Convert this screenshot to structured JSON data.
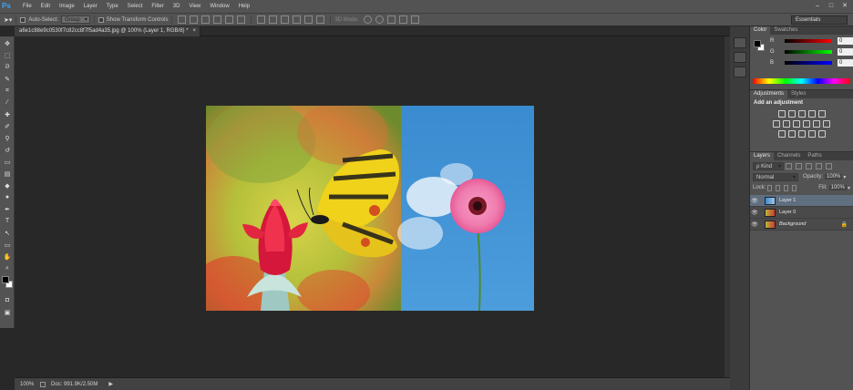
{
  "app": {
    "logo": "Ps",
    "menus": [
      "File",
      "Edit",
      "Image",
      "Layer",
      "Type",
      "Select",
      "Filter",
      "3D",
      "View",
      "Window",
      "Help"
    ]
  },
  "window_controls": {
    "minimize": "–",
    "maximize": "□",
    "close": "✕"
  },
  "options": {
    "auto_select_label": "Auto-Select:",
    "auto_select_value": "Group",
    "transform_label": "Show Transform Controls",
    "mode_3d_label": "3D Mode:",
    "workspace": "Essentials"
  },
  "document": {
    "tab_title": "a6e1c88e9c0530f7c82cc8f7f5ad4a35.jpg @ 100% (Layer 1, RGB/8) *",
    "tab_close": "×"
  },
  "status": {
    "zoom": "100%",
    "doc_info": "Doc: 991.9K/2.50M",
    "arrow": "▶"
  },
  "color_panel": {
    "tabs": [
      "Color",
      "Swatches"
    ],
    "channels": [
      {
        "label": "R",
        "value": "0"
      },
      {
        "label": "G",
        "value": "0"
      },
      {
        "label": "B",
        "value": "0"
      }
    ]
  },
  "adjustments_panel": {
    "tabs": [
      "Adjustments",
      "Styles"
    ],
    "heading": "Add an adjustment"
  },
  "layers_panel": {
    "tabs": [
      "Layers",
      "Channels",
      "Paths"
    ],
    "filter_kind": "ρ Kind",
    "blend_mode": "Normal",
    "opacity_label": "Opacity:",
    "opacity_value": "100%",
    "lock_label": "Lock:",
    "fill_label": "Fill:",
    "fill_value": "100%",
    "layers": [
      {
        "name": "Layer 1",
        "selected": true
      },
      {
        "name": "Layer 0",
        "selected": false
      },
      {
        "name": "Background",
        "selected": false
      }
    ]
  },
  "colors": {
    "accent": "#31a8ff",
    "ui_dark": "#282828",
    "ui_panel": "#535353"
  }
}
